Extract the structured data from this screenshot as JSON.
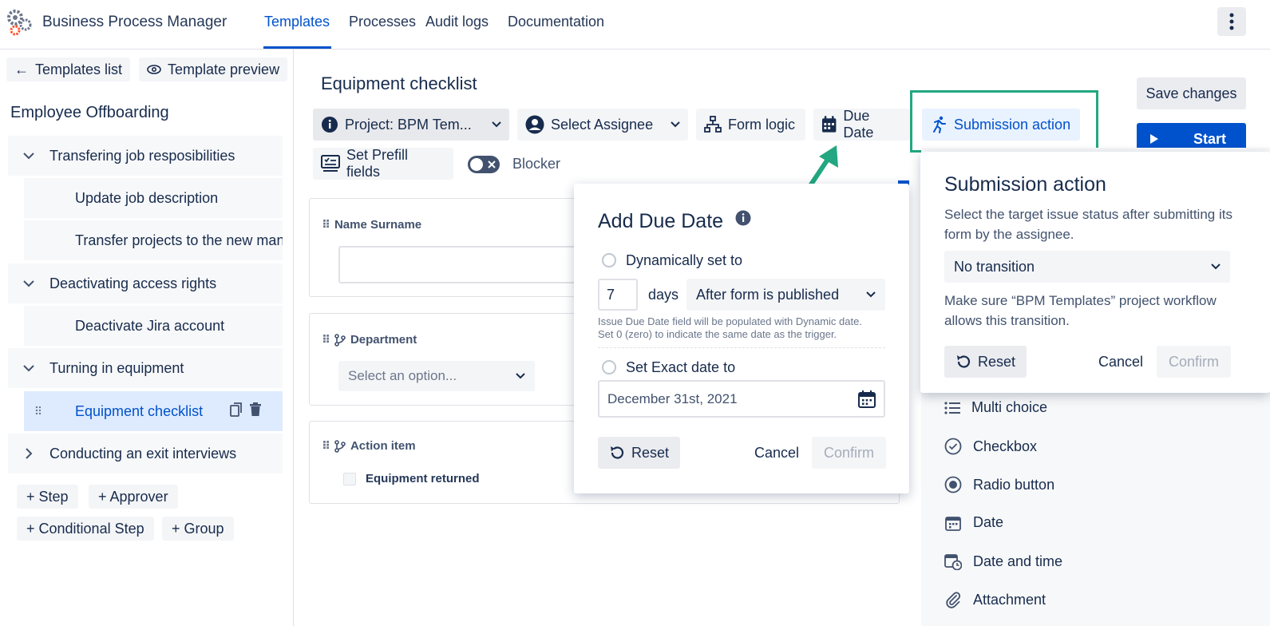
{
  "app": {
    "title": "Business Process Manager"
  },
  "nav": {
    "tabs": [
      "Templates",
      "Processes",
      "Audit logs",
      "Documentation"
    ]
  },
  "left": {
    "templates_list": "Templates list",
    "template_preview": "Template preview",
    "process_title": "Employee Offboarding",
    "tree": {
      "group1": "Transfering job resposibilities",
      "g1_item1": "Update job description",
      "g1_item2": "Transfer projects to the new manager",
      "group2": "Deactivating access rights",
      "g2_item1": "Deactivate Jira account",
      "group3": "Turning in equipment",
      "g3_item1": "Equipment checklist",
      "group4": "Conducting an exit interviews"
    },
    "buttons": {
      "step": "+ Step",
      "approver": "+ Approver",
      "conditional": "+ Conditional Step",
      "group": "+ Group"
    }
  },
  "form": {
    "title": "Equipment checklist",
    "toolbar": {
      "project": "Project: BPM Tem...",
      "assignee": "Select Assignee",
      "form_logic": "Form logic",
      "due_date": "Due Date",
      "submission": "Submission action",
      "prefill": "Set Prefill fields",
      "blocker": "Blocker"
    },
    "fields": {
      "name_label": "Name Surname",
      "department_label": "Department",
      "department_placeholder": "Select an option...",
      "action_label": "Action item",
      "action_checkbox": "Equipment returned"
    }
  },
  "due_popup": {
    "title": "Add Due Date",
    "dynamic_label": "Dynamically set to",
    "days_value": "7",
    "days_label": "days",
    "trigger": "After form is published",
    "help_line1": "Issue Due Date field will be populated with Dynamic date.",
    "help_line2": "Set 0 (zero) to indicate the same date as the trigger.",
    "exact_label": "Set Exact date to",
    "exact_value": "December 31st, 2021",
    "reset": "Reset",
    "cancel": "Cancel",
    "confirm": "Confirm"
  },
  "right": {
    "save": "Save changes",
    "start": "Start",
    "palette": [
      "Multi choice",
      "Checkbox",
      "Radio button",
      "Date",
      "Date and time",
      "Attachment"
    ]
  },
  "sub_popup": {
    "title": "Submission action",
    "desc": "Select the target issue status after submitting its form by the assignee.",
    "transition": "No transition",
    "note": "Make sure “BPM Templates” project workflow allows this transition.",
    "reset": "Reset",
    "cancel": "Cancel",
    "confirm": "Confirm"
  },
  "colors": {
    "accent": "#0052cc",
    "highlight": "#22a780",
    "selected_bg": "#deebff"
  }
}
